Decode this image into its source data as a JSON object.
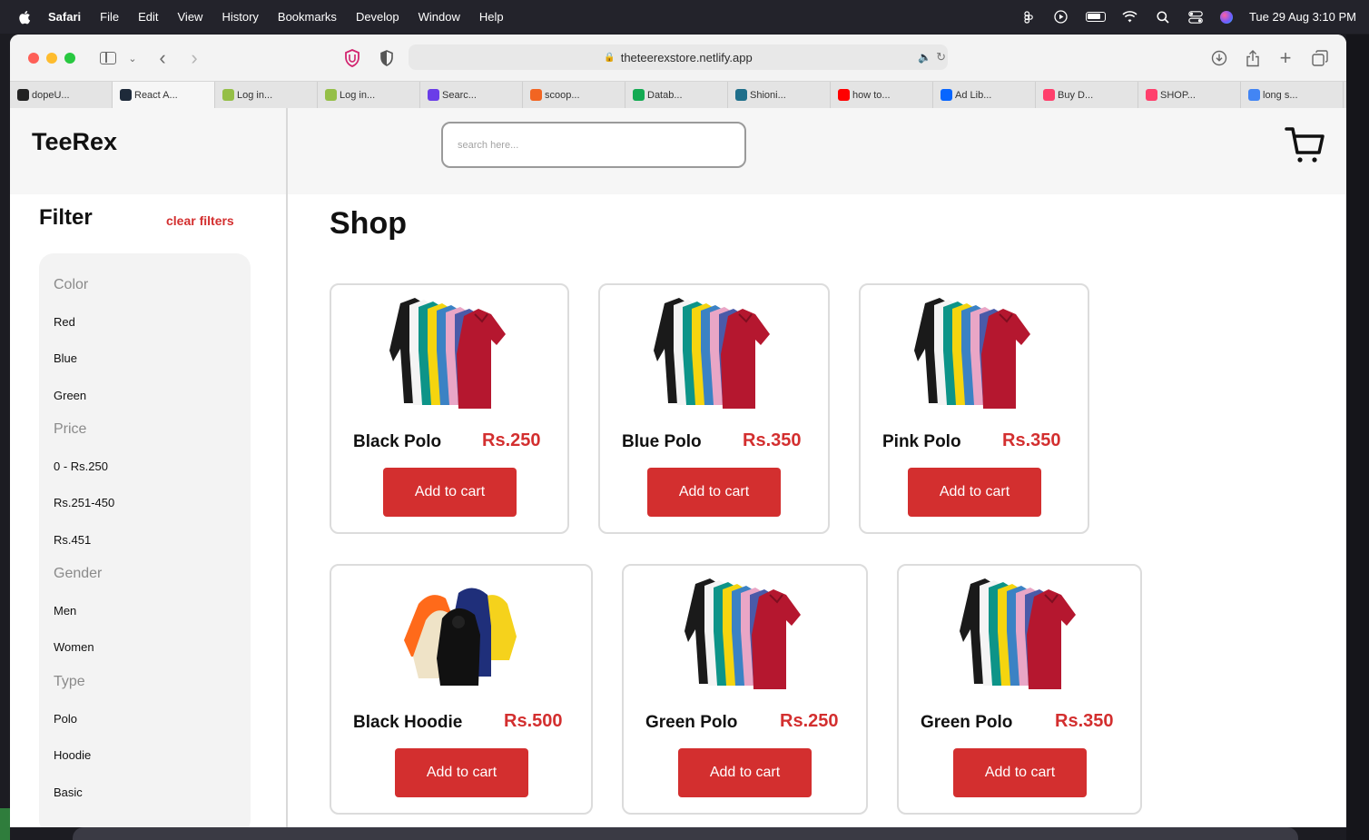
{
  "menubar": {
    "app": "Safari",
    "items": [
      "File",
      "Edit",
      "View",
      "History",
      "Bookmarks",
      "Develop",
      "Window",
      "Help"
    ],
    "datetime": "Tue 29 Aug  3:10 PM"
  },
  "browser": {
    "url": "theteerexstore.netlify.app",
    "tabs": [
      {
        "label": "dopeU...",
        "color": "#222222"
      },
      {
        "label": "React A...",
        "color": "#1e2a3a"
      },
      {
        "label": "Log in...",
        "color": "#95bf47"
      },
      {
        "label": "Log in...",
        "color": "#95bf47"
      },
      {
        "label": "Searc...",
        "color": "#6a3de8"
      },
      {
        "label": "scoop...",
        "color": "#f26522"
      },
      {
        "label": "Datab...",
        "color": "#13aa52"
      },
      {
        "label": "Shioni...",
        "color": "#1f6f8b"
      },
      {
        "label": "how to...",
        "color": "#ff0000"
      },
      {
        "label": "Ad Lib...",
        "color": "#0866ff"
      },
      {
        "label": "Buy D...",
        "color": "#ff3f6c"
      },
      {
        "label": "SHOP...",
        "color": "#ff3f6c"
      },
      {
        "label": "long s...",
        "color": "#4285f4"
      }
    ]
  },
  "site": {
    "brand": "TeeRex",
    "search_placeholder": "search here...",
    "filter_title": "Filter",
    "clear_label": "clear filters",
    "shop_title": "Shop",
    "filters": [
      {
        "group": "Color",
        "options": [
          "Red",
          "Blue",
          "Green"
        ]
      },
      {
        "group": "Price",
        "options": [
          "0 - Rs.250",
          "Rs.251-450",
          "Rs.451"
        ]
      },
      {
        "group": "Gender",
        "options": [
          "Men",
          "Women"
        ]
      },
      {
        "group": "Type",
        "options": [
          "Polo",
          "Hoodie",
          "Basic"
        ]
      }
    ],
    "add_label": "Add to cart",
    "products": [
      {
        "name": "Black Polo",
        "price": "Rs.250",
        "image": "polo-shirts"
      },
      {
        "name": "Blue Polo",
        "price": "Rs.350",
        "image": "polo-shirts"
      },
      {
        "name": "Pink Polo",
        "price": "Rs.350",
        "image": "polo-shirts"
      },
      {
        "name": "Black Hoodie",
        "price": "Rs.500",
        "image": "hoodies"
      },
      {
        "name": "Green Polo",
        "price": "Rs.250",
        "image": "polo-shirts"
      },
      {
        "name": "Green Polo",
        "price": "Rs.350",
        "image": "polo-shirts"
      }
    ]
  },
  "colors": {
    "accent": "#d32f2f"
  }
}
